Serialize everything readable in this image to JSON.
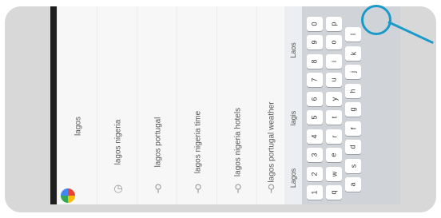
{
  "search": {
    "query": "lagos",
    "suggestions": [
      "lagos nigeria",
      "lagos portugal",
      "lagos nigeria time",
      "lagos nigeria hotels",
      "lagos portugal weather"
    ]
  },
  "keyboard": {
    "predictions": [
      "Lagos",
      "lagis",
      "Laos"
    ],
    "rows": [
      [
        "1",
        "2",
        "3",
        "4",
        "5",
        "6",
        "7",
        "8",
        "9",
        "0"
      ],
      [
        "q",
        "w",
        "e",
        "r",
        "t",
        "y",
        "u",
        "i",
        "o",
        "p"
      ],
      [
        "a",
        "s",
        "d",
        "f",
        "g",
        "h",
        "j",
        "k",
        "l"
      ]
    ]
  },
  "colors": {
    "callout": "#1a9ac9",
    "card_background": "#d8d8d8"
  }
}
